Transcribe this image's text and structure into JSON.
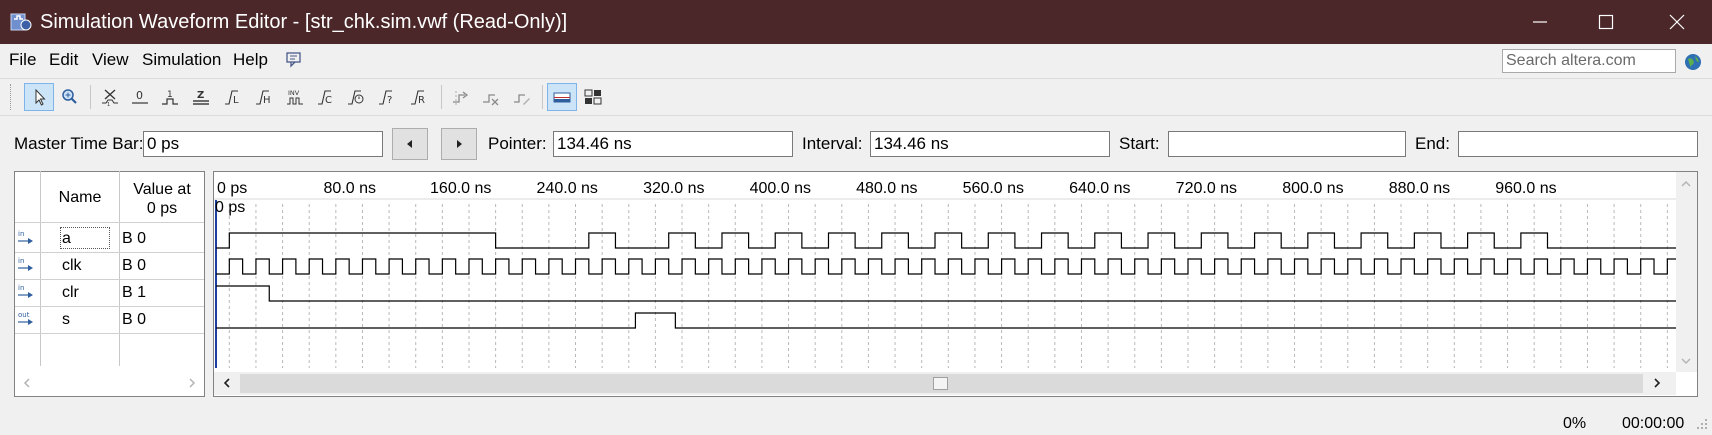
{
  "window": {
    "title": "Simulation Waveform Editor - [str_chk.sim.vwf (Read-Only)]",
    "icons": [
      "app-icon",
      "minimize-icon",
      "maximize-icon",
      "close-icon"
    ],
    "titlebar_color": "#4b2729"
  },
  "menu": {
    "items": [
      "File",
      "Edit",
      "View",
      "Simulation",
      "Help"
    ],
    "search_placeholder": "Search altera.com"
  },
  "toolbar": {
    "tools": [
      "selection-tool-icon",
      "zoom-tool-icon",
      "forcing-unknown-icon",
      "forcing-low-icon",
      "forcing-high-icon",
      "high-impedance-icon",
      "weak-low-icon",
      "weak-high-icon",
      "invert-icon",
      "count-value-icon",
      "overwrite-clock-icon",
      "random-values-icon",
      "overwrite-value-icon",
      "snap-to-grid-icon",
      "sort-icon",
      "waveform-compare-icon",
      "editing-mode-icon",
      "grid-settings-icon"
    ],
    "active": [
      "selection-tool-icon",
      "editing-mode-icon"
    ]
  },
  "timebar": {
    "master_label": "Master Time Bar:",
    "master_value": "0 ps",
    "pointer_label": "Pointer:",
    "pointer_value": "134.46 ns",
    "interval_label": "Interval:",
    "interval_value": "134.46 ns",
    "start_label": "Start:",
    "start_value": "",
    "end_label": "End:",
    "end_value": ""
  },
  "table": {
    "name_header": "Name",
    "value_header_line1": "Value at",
    "value_header_line2": "0 ps",
    "signals": [
      {
        "io": "in",
        "name": "a",
        "value": "B 0"
      },
      {
        "io": "in",
        "name": "clk",
        "value": "B 0"
      },
      {
        "io": "in",
        "name": "clr",
        "value": "B 1"
      },
      {
        "io": "out",
        "name": "s",
        "value": "B 0"
      }
    ]
  },
  "waveform": {
    "ruler_labels": [
      "0 ps",
      "80.0 ns",
      "160.0 ns",
      "240.0 ns",
      "320.0 ns",
      "400.0 ns",
      "480.0 ns",
      "560.0 ns",
      "640.0 ns",
      "720.0 ns",
      "800.0 ns",
      "880.0 ns",
      "960.0 ns"
    ],
    "time_bar_label": "0 ps",
    "visible_range_ns": [
      0,
      1000
    ],
    "clk_period_ns": 20,
    "signals": {
      "a": {
        "initial": 0,
        "transitions_ns": [
          10,
          210,
          280,
          300,
          340,
          360,
          380,
          400,
          420,
          440,
          460,
          480,
          500,
          520,
          540,
          560,
          580,
          600,
          620,
          640,
          660,
          680,
          700,
          720,
          740,
          760,
          780,
          800,
          820,
          840,
          860,
          880,
          900,
          920,
          940,
          960,
          980,
          1000
        ]
      },
      "clk": {
        "initial": 0,
        "period_ns": 20,
        "first_rise_ns": 10
      },
      "clr": {
        "initial": 1,
        "transitions_ns": [
          40
        ]
      },
      "s": {
        "initial": 0,
        "transitions_ns": [
          315,
          345
        ]
      }
    }
  },
  "status": {
    "progress": "0%",
    "time": "00:00:00"
  }
}
